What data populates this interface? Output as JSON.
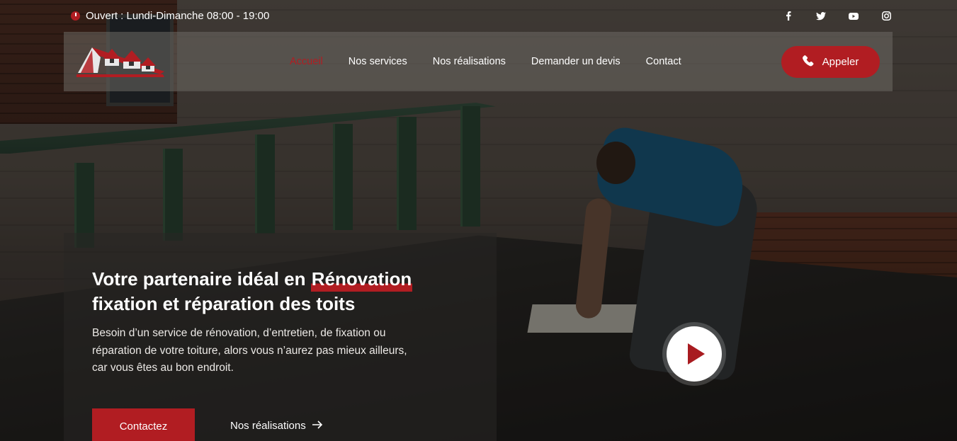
{
  "topbar": {
    "hours": "Ouvert : Lundi-Dimanche 08:00 - 19:00",
    "socials": [
      "facebook-icon",
      "twitter-icon",
      "youtube-icon",
      "instagram-icon"
    ]
  },
  "nav": {
    "items": [
      {
        "label": "Accueil",
        "active": true
      },
      {
        "label": "Nos services",
        "active": false
      },
      {
        "label": "Nos réalisations",
        "active": false
      },
      {
        "label": "Demander un devis",
        "active": false
      },
      {
        "label": "Contact",
        "active": false
      }
    ],
    "call_label": "Appeler"
  },
  "hero": {
    "title_before": "Votre partenaire idéal en ",
    "title_highlight": "Rénovation",
    "title_after": "fixation et réparation des toits",
    "description": "Besoin d’un service de rénovation, d’entretien, de fixation ou réparation de votre toiture, alors vous n’aurez pas mieux ailleurs, car vous êtes au bon endroit.",
    "primary_button": "Contactez",
    "secondary_button": "Nos réalisations"
  },
  "colors": {
    "accent": "#b11d22",
    "text": "#ffffff"
  }
}
